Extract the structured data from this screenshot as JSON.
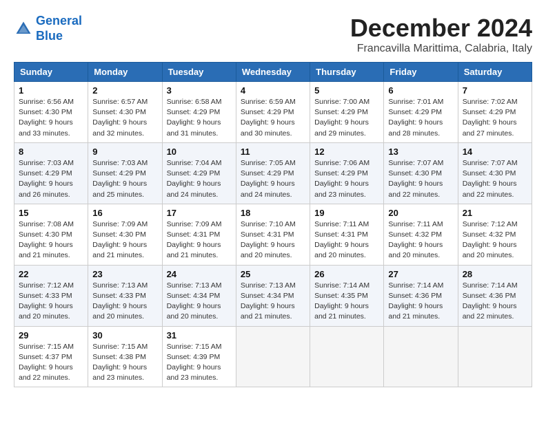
{
  "header": {
    "logo_line1": "General",
    "logo_line2": "Blue",
    "month_title": "December 2024",
    "location": "Francavilla Marittima, Calabria, Italy"
  },
  "days_of_week": [
    "Sunday",
    "Monday",
    "Tuesday",
    "Wednesday",
    "Thursday",
    "Friday",
    "Saturday"
  ],
  "weeks": [
    [
      {
        "day": "1",
        "sunrise": "6:56 AM",
        "sunset": "4:30 PM",
        "daylight": "9 hours and 33 minutes."
      },
      {
        "day": "2",
        "sunrise": "6:57 AM",
        "sunset": "4:30 PM",
        "daylight": "9 hours and 32 minutes."
      },
      {
        "day": "3",
        "sunrise": "6:58 AM",
        "sunset": "4:29 PM",
        "daylight": "9 hours and 31 minutes."
      },
      {
        "day": "4",
        "sunrise": "6:59 AM",
        "sunset": "4:29 PM",
        "daylight": "9 hours and 30 minutes."
      },
      {
        "day": "5",
        "sunrise": "7:00 AM",
        "sunset": "4:29 PM",
        "daylight": "9 hours and 29 minutes."
      },
      {
        "day": "6",
        "sunrise": "7:01 AM",
        "sunset": "4:29 PM",
        "daylight": "9 hours and 28 minutes."
      },
      {
        "day": "7",
        "sunrise": "7:02 AM",
        "sunset": "4:29 PM",
        "daylight": "9 hours and 27 minutes."
      }
    ],
    [
      {
        "day": "8",
        "sunrise": "7:03 AM",
        "sunset": "4:29 PM",
        "daylight": "9 hours and 26 minutes."
      },
      {
        "day": "9",
        "sunrise": "7:03 AM",
        "sunset": "4:29 PM",
        "daylight": "9 hours and 25 minutes."
      },
      {
        "day": "10",
        "sunrise": "7:04 AM",
        "sunset": "4:29 PM",
        "daylight": "9 hours and 24 minutes."
      },
      {
        "day": "11",
        "sunrise": "7:05 AM",
        "sunset": "4:29 PM",
        "daylight": "9 hours and 24 minutes."
      },
      {
        "day": "12",
        "sunrise": "7:06 AM",
        "sunset": "4:29 PM",
        "daylight": "9 hours and 23 minutes."
      },
      {
        "day": "13",
        "sunrise": "7:07 AM",
        "sunset": "4:30 PM",
        "daylight": "9 hours and 22 minutes."
      },
      {
        "day": "14",
        "sunrise": "7:07 AM",
        "sunset": "4:30 PM",
        "daylight": "9 hours and 22 minutes."
      }
    ],
    [
      {
        "day": "15",
        "sunrise": "7:08 AM",
        "sunset": "4:30 PM",
        "daylight": "9 hours and 21 minutes."
      },
      {
        "day": "16",
        "sunrise": "7:09 AM",
        "sunset": "4:30 PM",
        "daylight": "9 hours and 21 minutes."
      },
      {
        "day": "17",
        "sunrise": "7:09 AM",
        "sunset": "4:31 PM",
        "daylight": "9 hours and 21 minutes."
      },
      {
        "day": "18",
        "sunrise": "7:10 AM",
        "sunset": "4:31 PM",
        "daylight": "9 hours and 20 minutes."
      },
      {
        "day": "19",
        "sunrise": "7:11 AM",
        "sunset": "4:31 PM",
        "daylight": "9 hours and 20 minutes."
      },
      {
        "day": "20",
        "sunrise": "7:11 AM",
        "sunset": "4:32 PM",
        "daylight": "9 hours and 20 minutes."
      },
      {
        "day": "21",
        "sunrise": "7:12 AM",
        "sunset": "4:32 PM",
        "daylight": "9 hours and 20 minutes."
      }
    ],
    [
      {
        "day": "22",
        "sunrise": "7:12 AM",
        "sunset": "4:33 PM",
        "daylight": "9 hours and 20 minutes."
      },
      {
        "day": "23",
        "sunrise": "7:13 AM",
        "sunset": "4:33 PM",
        "daylight": "9 hours and 20 minutes."
      },
      {
        "day": "24",
        "sunrise": "7:13 AM",
        "sunset": "4:34 PM",
        "daylight": "9 hours and 20 minutes."
      },
      {
        "day": "25",
        "sunrise": "7:13 AM",
        "sunset": "4:34 PM",
        "daylight": "9 hours and 21 minutes."
      },
      {
        "day": "26",
        "sunrise": "7:14 AM",
        "sunset": "4:35 PM",
        "daylight": "9 hours and 21 minutes."
      },
      {
        "day": "27",
        "sunrise": "7:14 AM",
        "sunset": "4:36 PM",
        "daylight": "9 hours and 21 minutes."
      },
      {
        "day": "28",
        "sunrise": "7:14 AM",
        "sunset": "4:36 PM",
        "daylight": "9 hours and 22 minutes."
      }
    ],
    [
      {
        "day": "29",
        "sunrise": "7:15 AM",
        "sunset": "4:37 PM",
        "daylight": "9 hours and 22 minutes."
      },
      {
        "day": "30",
        "sunrise": "7:15 AM",
        "sunset": "4:38 PM",
        "daylight": "9 hours and 23 minutes."
      },
      {
        "day": "31",
        "sunrise": "7:15 AM",
        "sunset": "4:39 PM",
        "daylight": "9 hours and 23 minutes."
      },
      null,
      null,
      null,
      null
    ]
  ]
}
